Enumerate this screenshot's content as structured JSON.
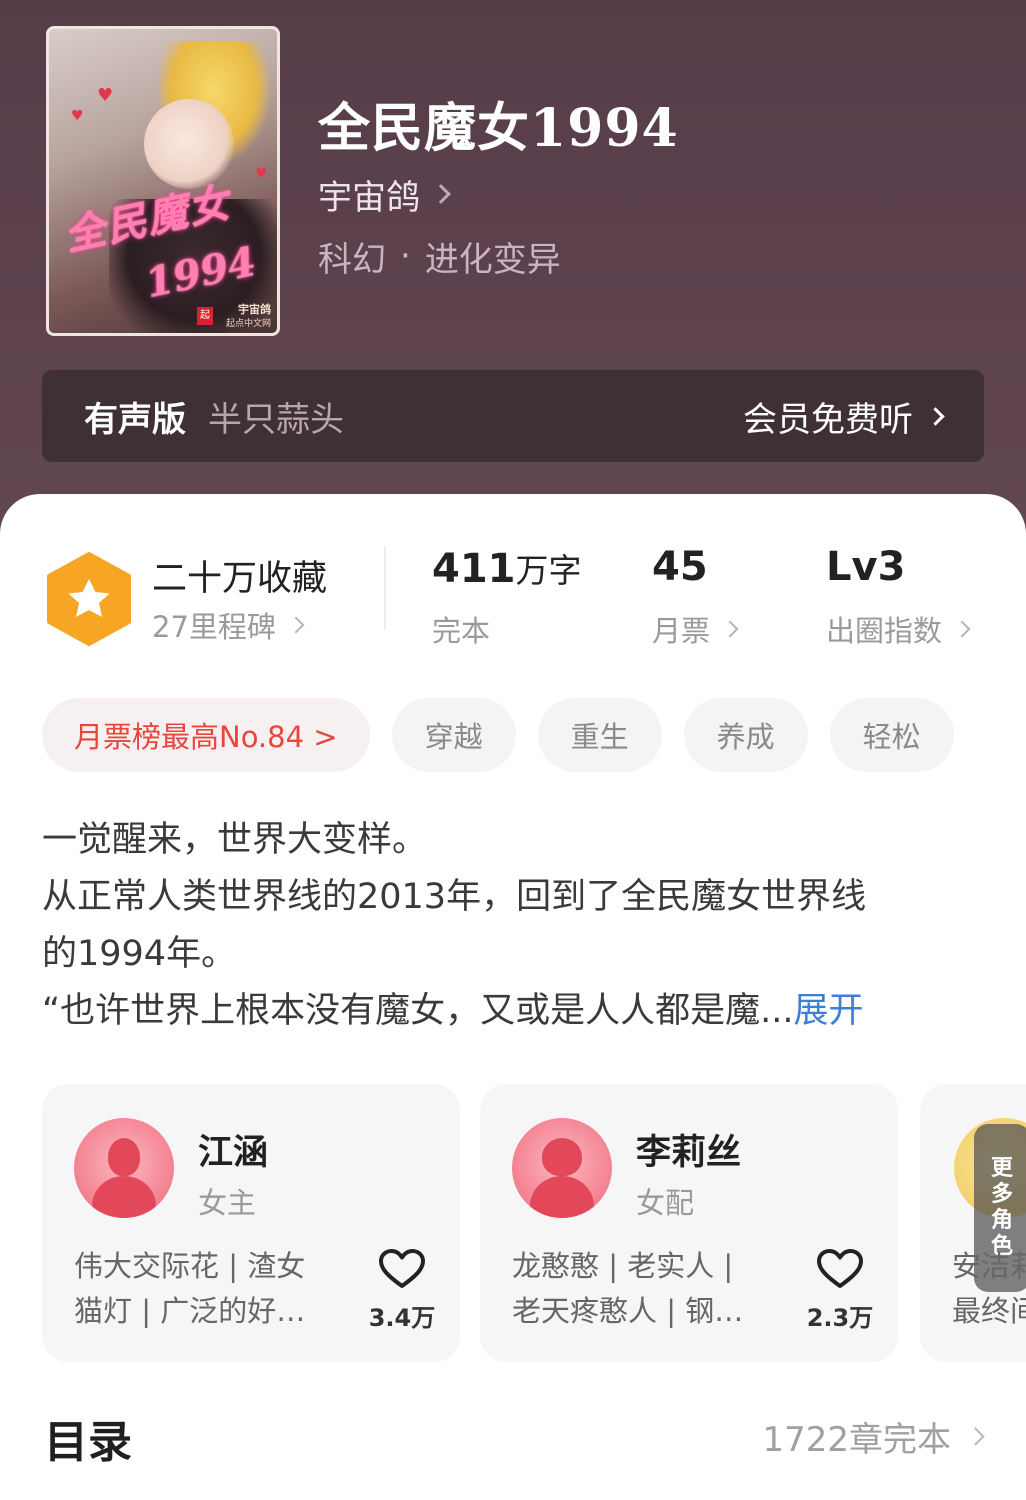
{
  "book": {
    "title": "全民魔女1994",
    "author": "宇宙鸽",
    "category": "科幻",
    "separator": "·",
    "subcategory": "进化变异",
    "cover": {
      "title_text": "全民魔女",
      "year_text": "1994",
      "author_text": "宇宙鸽",
      "publisher_text": "起点中文网",
      "badge_text": "起"
    }
  },
  "audio": {
    "label": "有声版",
    "narrator": "半只蒜头",
    "cta": "会员免费听"
  },
  "stats": {
    "collect_main": "二十万收藏",
    "collect_sub": "27里程碑",
    "words_num": "411",
    "words_unit": "万字",
    "words_sub": "完本",
    "tickets_num": "45",
    "tickets_sub": "月票",
    "level_num": "Lv3",
    "level_sub": "出圈指数"
  },
  "tags": {
    "rank": "月票榜最高No.84 >",
    "items": [
      "穿越",
      "重生",
      "养成",
      "轻松"
    ]
  },
  "intro": {
    "line1": "一觉醒来，世界大变样。",
    "line2": "从正常人类世界线的2013年，回到了全民魔女世界线",
    "line3": "的1994年。",
    "line4": "“也许世界上根本没有魔女，又或是人人都是魔...",
    "expand": "展开"
  },
  "roles": [
    {
      "name": "江涵",
      "type": "女主",
      "traits_line1": "伟大交际花 | 渣女",
      "traits_line2": "猫灯 | 广泛的好…",
      "likes": "3.4万"
    },
    {
      "name": "李莉丝",
      "type": "女配",
      "traits_line1": "龙憨憨 | 老实人 |",
      "traits_line2": "老天疼憨人 | 钢…",
      "likes": "2.3万"
    }
  ],
  "more_roles": {
    "label": [
      "更",
      "多",
      "角",
      "色"
    ],
    "traits_line1": "安洁莉",
    "traits_line2": "最终间"
  },
  "toc": {
    "title": "目录",
    "meta": "1722章完本"
  },
  "colors": {
    "header_bg": "#5c414d",
    "audio_bar_bg": "#3f2f36",
    "rank_tag": "#e8453c",
    "expand_link": "#3b7fd8",
    "badge_hex": "#f6a623"
  }
}
